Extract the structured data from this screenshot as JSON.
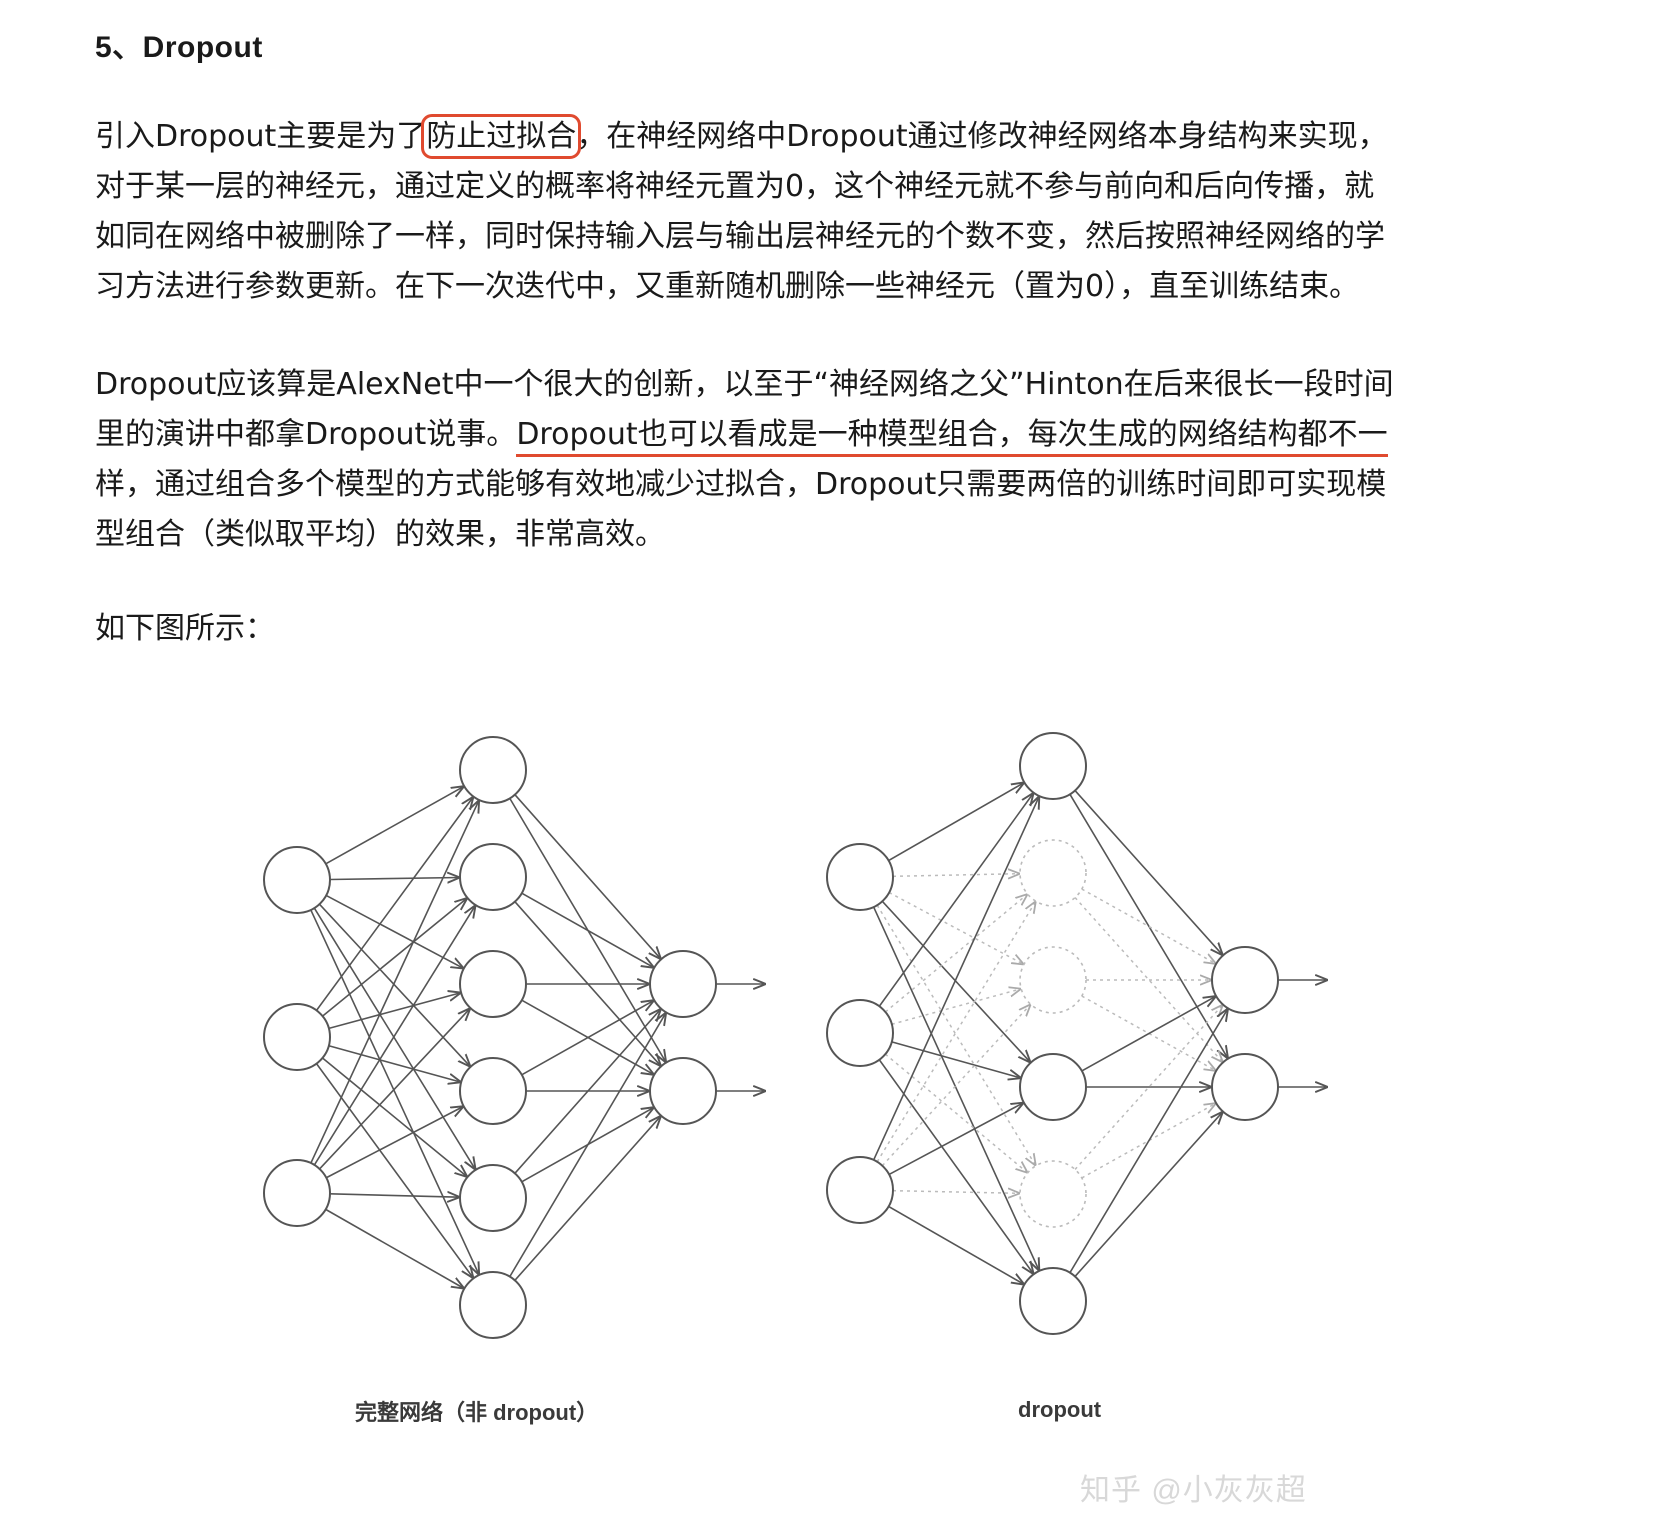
{
  "heading": "5、Dropout",
  "paragraph1": {
    "line1_before": "引入Dropout主要是为了",
    "line1_boxed": "防止过拟合",
    "line1_after": "，在神经网络中Dropout通过修改神经网络本身结构来实现，",
    "line2": "对于某一层的神经元，通过定义的概率将神经元置为0，这个神经元就不参与前向和后向传播，就",
    "line3": "如同在网络中被删除了一样，同时保持输入层与输出层神经元的个数不变，然后按照神经网络的学",
    "line4": "习方法进行参数更新。在下一次迭代中，又重新随机删除一些神经元（置为0），直至训练结束。"
  },
  "paragraph2": {
    "line1": "Dropout应该算是AlexNet中一个很大的创新，以至于“神经网络之父”Hinton在后来很长一段时间",
    "line2_before": "里的演讲中都拿Dropout说事。",
    "line2_underlined": "Dropout也可以看成是一种模型组合，每次生成的网络结构都不一",
    "line3": "样，通过组合多个模型的方式能够有效地减少过拟合，Dropout只需要两倍的训练时间即可实现模",
    "line4": "型组合（类似取平均）的效果，非常高效。"
  },
  "paragraph3": "如下图所示：",
  "figure": {
    "caption_left": "完整网络（非 dropout）",
    "caption_right": "dropout",
    "watermark": "知乎 @小灰灰超",
    "line_color": "#555555",
    "dashed_color": "#bbbbbb",
    "highlight_color": "#e04a2f"
  }
}
